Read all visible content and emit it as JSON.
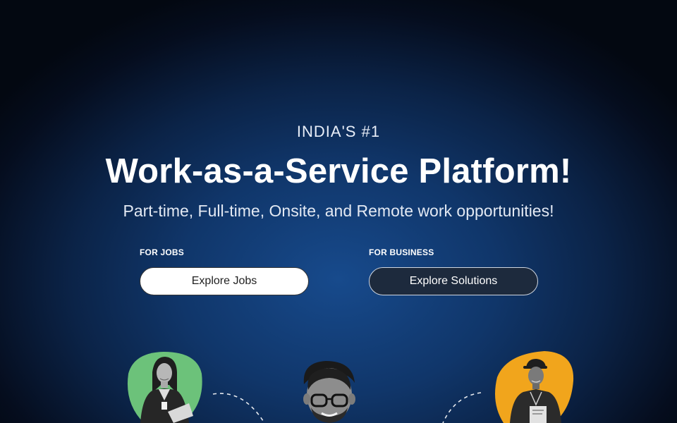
{
  "hero": {
    "eyebrow": "INDIA'S #1",
    "headline": "Work-as-a-Service Platform!",
    "subhead": "Part-time, Full-time, Onsite, and Remote work opportunities!"
  },
  "cta": {
    "jobs": {
      "label": "FOR JOBS",
      "button": "Explore Jobs"
    },
    "business": {
      "label": "FOR BUSINESS",
      "button": "Explore Solutions"
    }
  },
  "colors": {
    "background_center": "#174a8c",
    "background_edge": "#030811",
    "blob_green": "#6cc27a",
    "blob_yellow": "#f1a51c",
    "button_dark": "#1d2a3d"
  },
  "illustrations": [
    {
      "icon": "woman-with-clipboard-photo"
    },
    {
      "icon": "man-with-glasses-photo"
    },
    {
      "icon": "delivery-man-photo"
    }
  ]
}
